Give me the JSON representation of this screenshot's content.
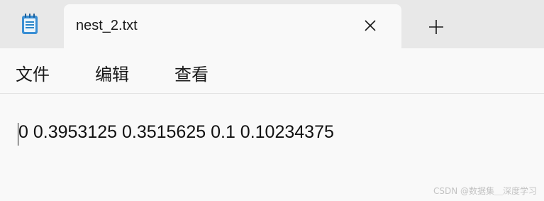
{
  "app": {
    "icon": "notepad-icon"
  },
  "tab": {
    "title": "nest_2.txt",
    "close_icon": "close-icon",
    "new_tab_icon": "plus-icon"
  },
  "menu": {
    "file": "文件",
    "edit": "编辑",
    "view": "查看"
  },
  "editor": {
    "content": "0 0.3953125 0.3515625 0.1 0.10234375"
  },
  "watermark": "CSDN @数据集＿深度学习",
  "colors": {
    "tabstrip_bg": "#e8e8e8",
    "content_bg": "#f9f9f9",
    "text": "#1a1a1a",
    "icon_blue": "#2a86c8"
  }
}
